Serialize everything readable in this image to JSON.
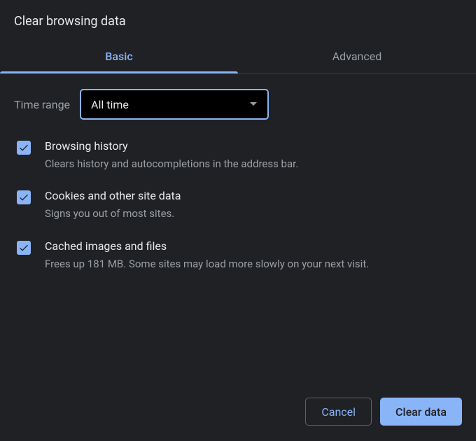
{
  "title": "Clear browsing data",
  "tabs": {
    "basic": "Basic",
    "advanced": "Advanced"
  },
  "time_range": {
    "label": "Time range",
    "value": "All time"
  },
  "options": {
    "browsing_history": {
      "title": "Browsing history",
      "desc": "Clears history and autocompletions in the address bar."
    },
    "cookies": {
      "title": "Cookies and other site data",
      "desc": "Signs you out of most sites."
    },
    "cache": {
      "title": "Cached images and files",
      "desc": "Frees up 181 MB. Some sites may load more slowly on your next visit."
    }
  },
  "buttons": {
    "cancel": "Cancel",
    "clear": "Clear data"
  }
}
